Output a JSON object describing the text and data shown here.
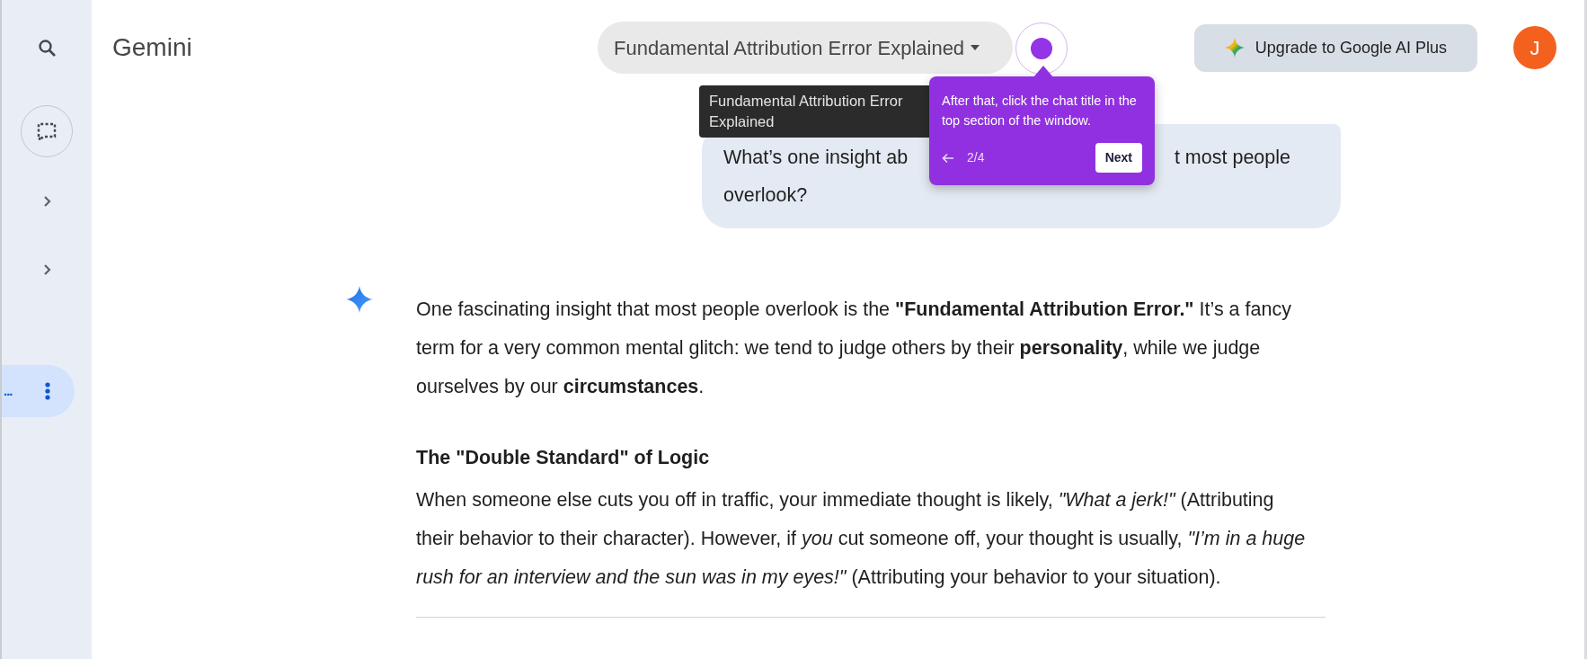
{
  "sidebar": {
    "items": [
      {
        "kind": "search"
      },
      {
        "kind": "new_chat"
      },
      {
        "kind": "expander",
        "expanded": false
      },
      {
        "kind": "expander",
        "expanded": false
      },
      {
        "kind": "chat",
        "text": "...",
        "selected": true
      }
    ]
  },
  "header": {
    "title": "Gemini",
    "chat_title": "Fundamental Attribution Error Explained",
    "upgrade_button": "Upgrade to Google AI Plus",
    "avatar": "J"
  },
  "tooltip": {
    "text": "Fundamental Attribution Error Explained"
  },
  "tour": {
    "text": "After that, click the chat title in the top section of the window.",
    "step": "2/4",
    "next_button": "Next"
  },
  "user_message": {
    "line_start": "What’s one insight ab",
    "line_end": "t most people",
    "line_2": "overlook?"
  },
  "response": {
    "blocks": [
      {
        "kind": "paragraph",
        "text": "One fascinating insight that most people overlook is the **\"Fundamental Attribution Error.\"** It’s a fancy term for a very common mental glitch: we tend to judge others by their **personality**, while we judge ourselves by our **circumstances**."
      },
      {
        "kind": "heading",
        "text": "The \"Double Standard\" of Logic"
      },
      {
        "kind": "paragraph",
        "text": "When someone else cuts you off in traffic, your immediate thought is likely, *\"What a jerk!\"* (Attributing their behavior to their character). However, if *you* cut someone off, your thought is usually, *\"I’m in a huge rush for an interview and the sun was in my eyes!\"* (Attributing your behavior to your situation)."
      }
    ]
  }
}
